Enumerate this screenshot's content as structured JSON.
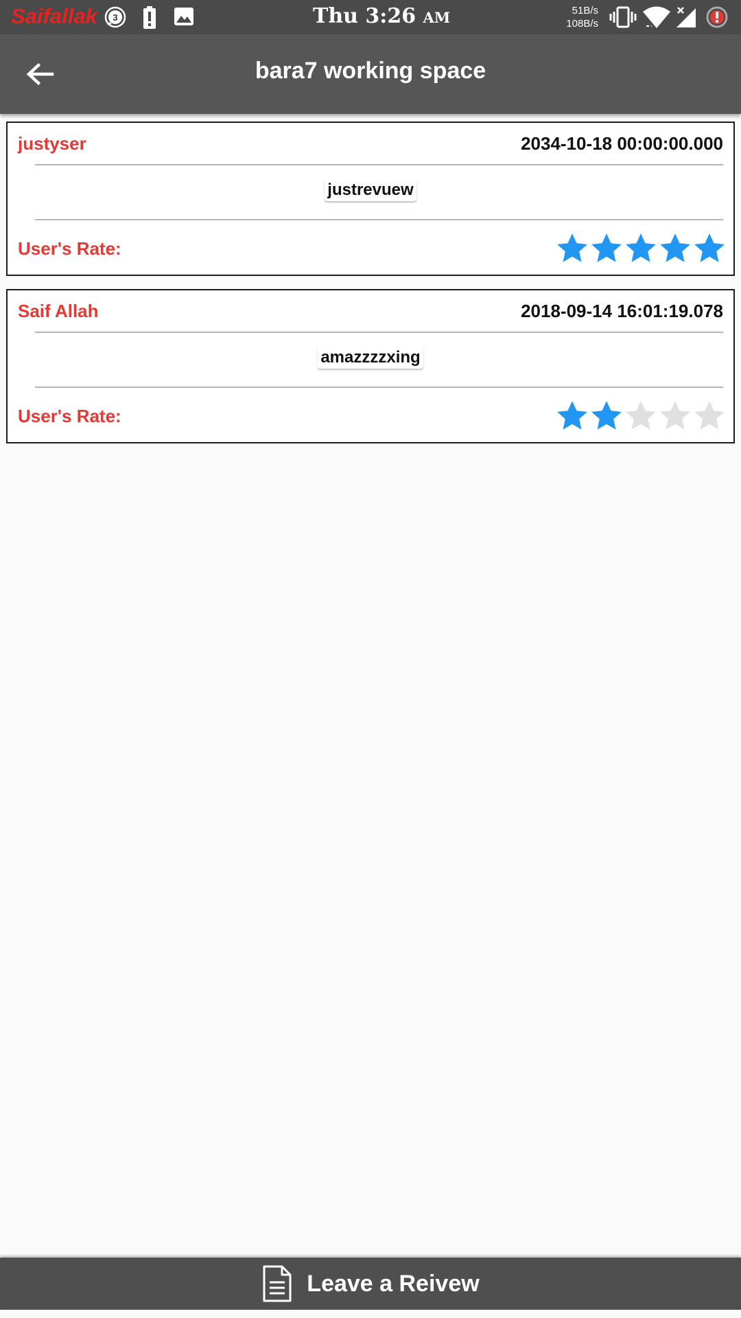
{
  "status_bar": {
    "brand": "Saifallak",
    "notification_count": "3",
    "time": "Thu 3:26",
    "ampm": "AM",
    "net_up": "51B/s",
    "net_down": "108B/s",
    "icons": [
      "chat-bubble-icon",
      "battery-alert-icon",
      "image-icon",
      "vibrate-icon",
      "wifi-icon",
      "signal-icon",
      "alert-icon"
    ]
  },
  "appbar": {
    "title": "bara7 working space",
    "back_icon": "arrow-back-icon"
  },
  "reviews": [
    {
      "user": "justyser",
      "date": "2034-10-18 00:00:00.000",
      "text": "justrevuew",
      "rate_label": "User's Rate:",
      "rating": 5,
      "max_rating": 5
    },
    {
      "user": "Saif Allah",
      "date": "2018-09-14 16:01:19.078",
      "text": "amazzzzxing",
      "rate_label": "User's Rate:",
      "rating": 2,
      "max_rating": 5
    }
  ],
  "colors": {
    "star_filled": "#2196f3",
    "star_empty": "#e0e0e0",
    "accent_red": "#e53935"
  },
  "bottom_button": {
    "label": "Leave a Reivew",
    "icon": "document-icon"
  }
}
